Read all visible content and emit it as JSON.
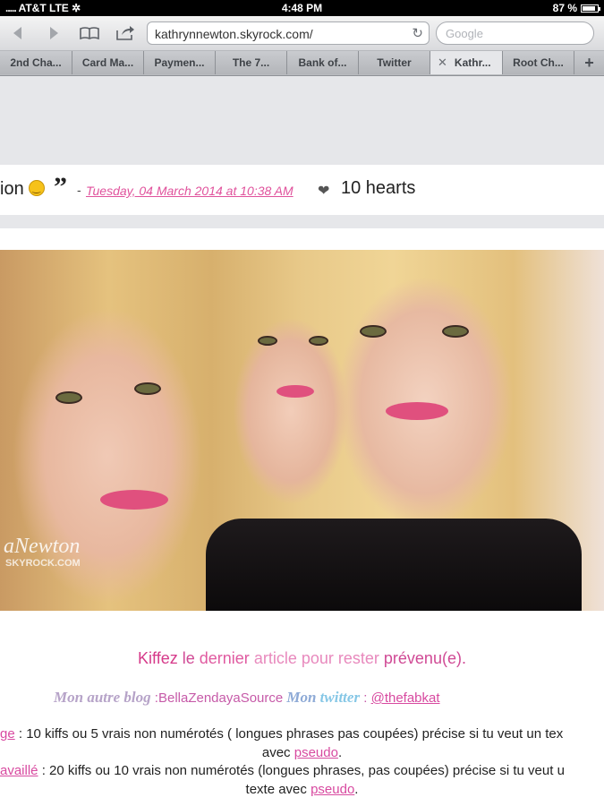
{
  "status_bar": {
    "carrier": "AT&T",
    "network": "LTE",
    "time": "4:48 PM",
    "battery": "87 %",
    "battery_level": 0.87
  },
  "toolbar": {
    "url": "kathrynnewton.skyrock.com/",
    "search_placeholder": "Google",
    "icons": [
      "back-arrow-icon",
      "forward-arrow-icon",
      "bookmarks-book-icon",
      "share-icon",
      "reload-icon"
    ]
  },
  "tabs": [
    {
      "label": "2nd Cha..."
    },
    {
      "label": "Card Ma..."
    },
    {
      "label": "Paymen..."
    },
    {
      "label": "The 7..."
    },
    {
      "label": "Bank of..."
    },
    {
      "label": "Twitter"
    },
    {
      "label": "Kathr...",
      "active": true
    },
    {
      "label": "Root Ch..."
    }
  ],
  "post": {
    "title_fragment": "ion",
    "quote_mark": "”",
    "dash": "-",
    "date": "Tuesday, 04 March 2014 at 10:38 AM",
    "hearts": "10 hearts"
  },
  "image": {
    "watermark": "aNewton",
    "watermark_sub": "SKYROCK.COM"
  },
  "content": {
    "kiffez": {
      "w1": "Kiffez",
      "w2": "le",
      "w3": "dernier",
      "w4": "article pour",
      "w5": "rester",
      "w6": "prévenu(e)."
    },
    "blog": {
      "label": "Mon autre blog",
      "sep": " :",
      "name": "BellaZendayaSource",
      "twitter_label_1": "Mon",
      "twitter_label_2": "twitter",
      "colon": " : ",
      "twitter_handle": "@thefabkat"
    },
    "rule1": {
      "prefix_link": "ge",
      "text": " : 10 kiffs ou 5 vrais non numérotés ( longues phrases pas coupées) précise si tu veut un tex",
      "line2_pre": "avec ",
      "line2_link": "pseudo",
      "line2_post": "."
    },
    "rule2": {
      "prefix_link": "availlé",
      "text": " : 20 kiffs ou 10 vrais non numérotés (longues phrases, pas coupées) précise si tu veut u",
      "line2_pre": "texte avec ",
      "line2_link": "pseudo",
      "line2_post": "."
    }
  }
}
